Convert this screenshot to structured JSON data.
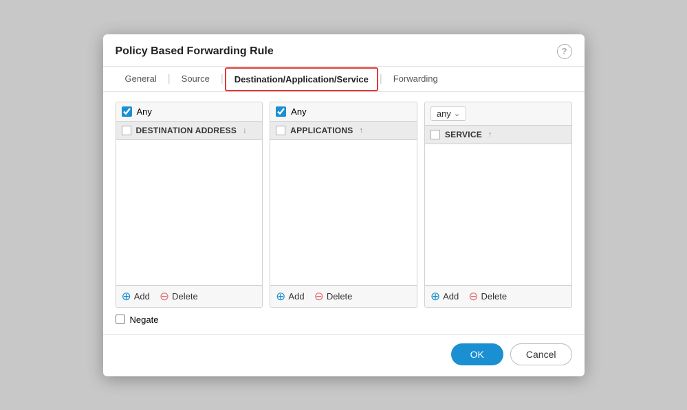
{
  "dialog": {
    "title": "Policy Based Forwarding Rule",
    "help_label": "?"
  },
  "tabs": [
    {
      "id": "general",
      "label": "General",
      "active": false
    },
    {
      "id": "source",
      "label": "Source",
      "active": false
    },
    {
      "id": "destination",
      "label": "Destination/Application/Service",
      "active": true
    },
    {
      "id": "forwarding",
      "label": "Forwarding",
      "active": false
    }
  ],
  "columns": [
    {
      "id": "destination-address",
      "any_label": "Any",
      "any_checked": true,
      "header_label": "DESTINATION ADDRESS",
      "header_sort": "↓",
      "add_label": "Add",
      "delete_label": "Delete"
    },
    {
      "id": "applications",
      "any_label": "Any",
      "any_checked": true,
      "header_label": "APPLICATIONS",
      "header_sort": "↑",
      "add_label": "Add",
      "delete_label": "Delete"
    },
    {
      "id": "service",
      "any_label": "",
      "any_checked": false,
      "has_dropdown": true,
      "dropdown_value": "any",
      "header_label": "SERVICE",
      "header_sort": "↑",
      "add_label": "Add",
      "delete_label": "Delete"
    }
  ],
  "negate": {
    "label": "Negate",
    "checked": false
  },
  "footer": {
    "ok_label": "OK",
    "cancel_label": "Cancel"
  }
}
